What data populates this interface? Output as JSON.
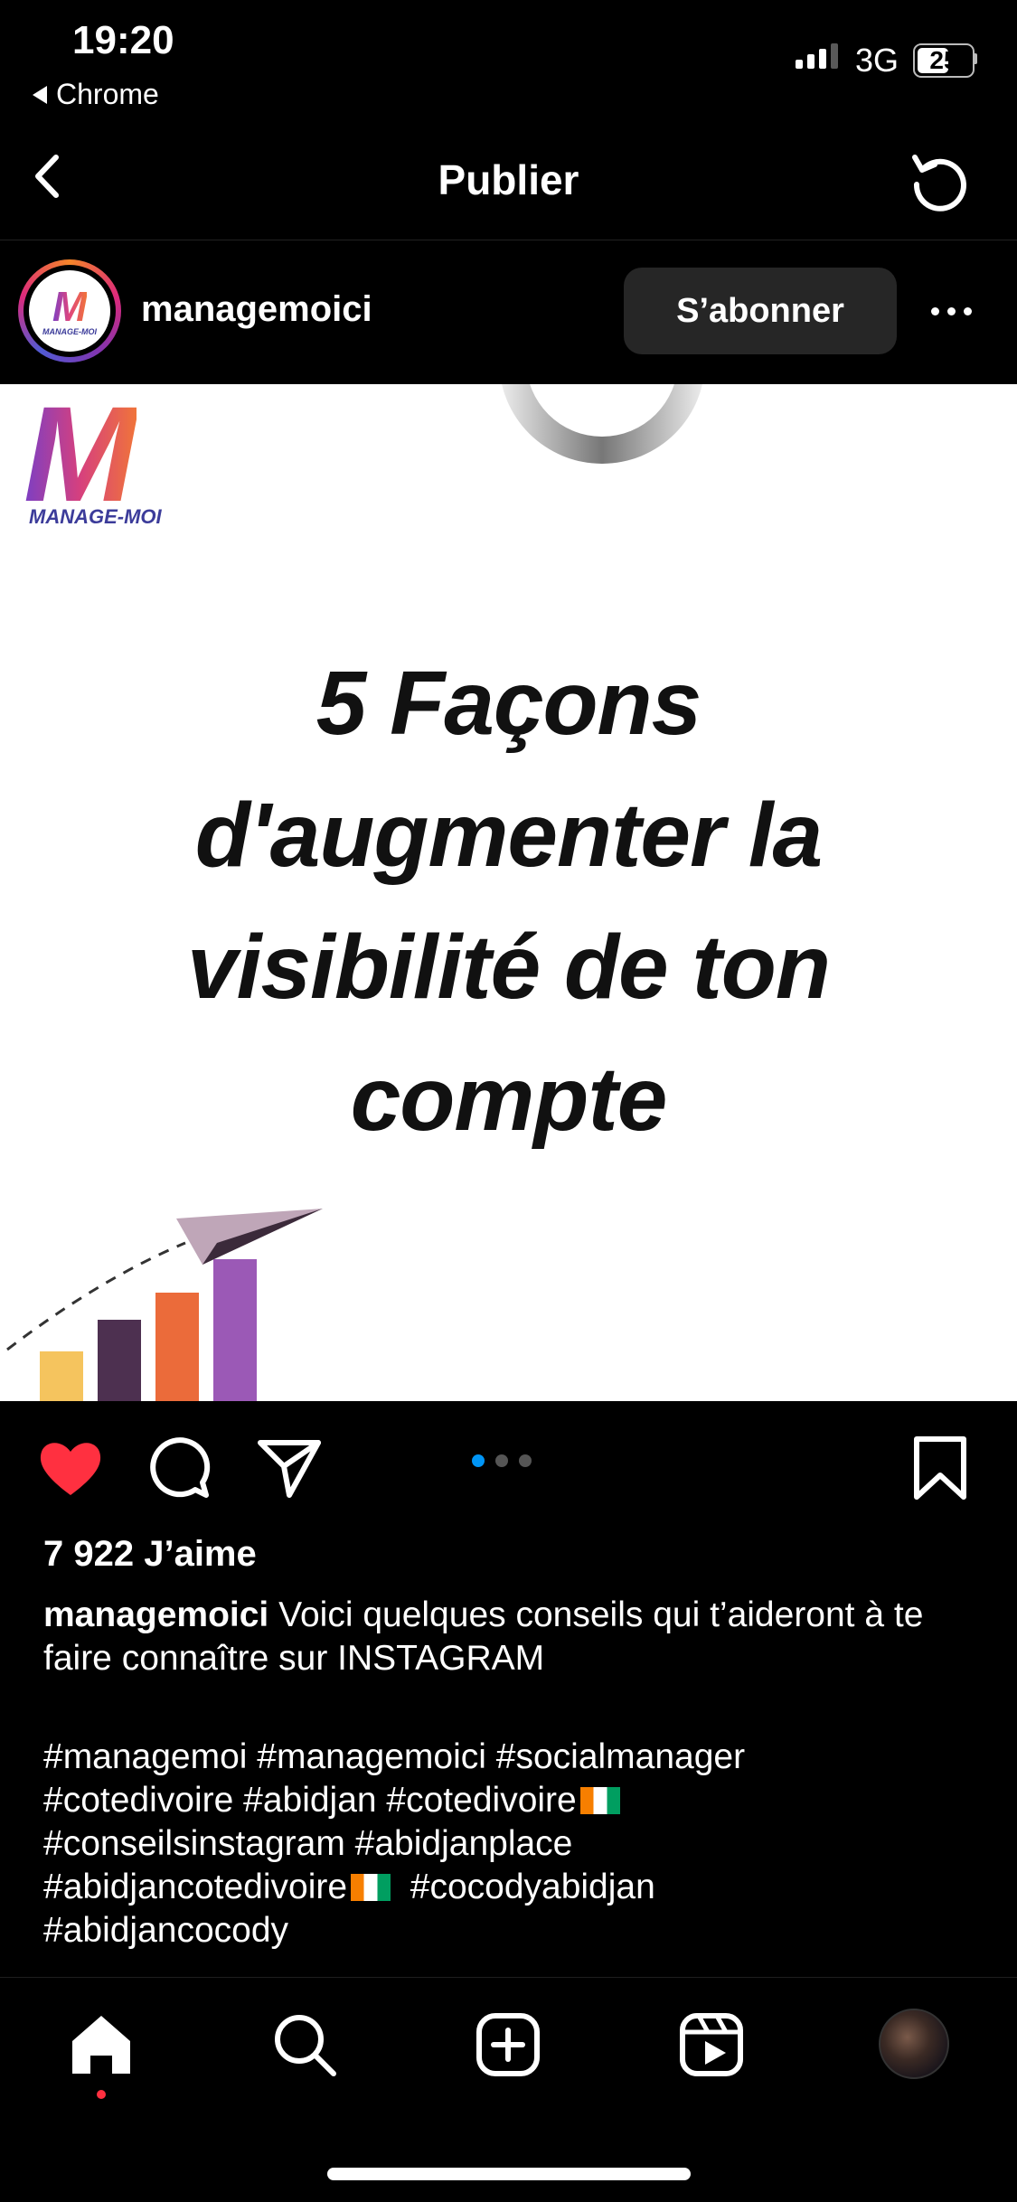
{
  "status_bar": {
    "time": "19:20",
    "back_app": "Chrome",
    "network": "3G",
    "battery": "25"
  },
  "header": {
    "title": "Publier",
    "back_icon": "chevron-left-icon",
    "refresh_icon": "refresh-icon"
  },
  "post": {
    "username": "managemoici",
    "follow_label": "S’abonner",
    "more_icon": "more-horizontal-icon",
    "image": {
      "logo_text": "MANAGE-MOI",
      "headline_lines": [
        "5 Façons",
        "d'augmenter la",
        "visibilité de ton",
        "compte"
      ],
      "bar_colors": [
        "#f5c45e",
        "#4d3050",
        "#eb6b3a",
        "#9b59b6"
      ],
      "plane_color": "#bfa6b8"
    },
    "likes": "7 922 J’aime",
    "caption_user": "managemoici",
    "caption_text": "Voici quelques conseils qui t’aideront à te faire connaître sur INSTAGRAM",
    "hashtag_lines": [
      "#managemoi #managemoici #socialmanager",
      "#cotedivoire #abidjan #cotedivoire",
      "#conseilsinstagram #abidjanplace",
      "#abidjancotedivoire",
      "#cocodyabidjan",
      "#abidjancocody"
    ],
    "carousel": {
      "count": 3,
      "active_index": 0,
      "active_color": "#0095f6",
      "inactive_color": "#555555"
    },
    "like_color": "#ff3040",
    "liked": true
  },
  "tab_bar": {
    "items": [
      "home-icon",
      "search-icon",
      "create-icon",
      "reels-icon",
      "profile-avatar"
    ],
    "active": "home-icon",
    "active_dot_color": "#ff3040"
  }
}
